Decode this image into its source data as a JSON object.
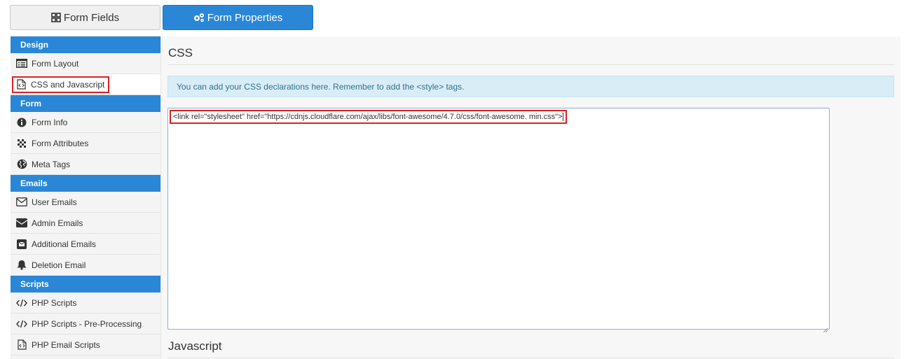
{
  "tabs": {
    "form_fields": "Form Fields",
    "form_properties": "Form Properties"
  },
  "sidebar": {
    "sections": [
      {
        "title": "Design",
        "items": [
          {
            "label": "Form Layout",
            "icon": "layout-list-icon"
          },
          {
            "label": "CSS and Javascript",
            "icon": "code-file-icon",
            "active": true
          }
        ]
      },
      {
        "title": "Form",
        "items": [
          {
            "label": "Form Info",
            "icon": "info-circle-icon"
          },
          {
            "label": "Form Attributes",
            "icon": "checkered-icon"
          },
          {
            "label": "Meta Tags",
            "icon": "globe-icon"
          }
        ]
      },
      {
        "title": "Emails",
        "items": [
          {
            "label": "User Emails",
            "icon": "envelope-outline-icon"
          },
          {
            "label": "Admin Emails",
            "icon": "envelope-solid-icon"
          },
          {
            "label": "Additional Emails",
            "icon": "envelope-square-icon"
          },
          {
            "label": "Deletion Email",
            "icon": "bell-icon"
          }
        ]
      },
      {
        "title": "Scripts",
        "items": [
          {
            "label": "PHP Scripts",
            "icon": "code-icon"
          },
          {
            "label": "PHP Scripts - Pre-Processing",
            "icon": "code-icon"
          },
          {
            "label": "PHP Email Scripts",
            "icon": "code-file-icon"
          }
        ]
      }
    ]
  },
  "main": {
    "css_heading": "CSS",
    "info_text": "You can add your CSS declarations here. Remember to add the <style> tags.",
    "css_editor_value": "<link rel=\"stylesheet\" href=\"https://cdnjs.cloudflare.com/ajax/libs/font-awesome/4.7.0/css/font-awesome. min.css\">",
    "js_heading": "Javascript"
  },
  "colors": {
    "accent": "#2a87d7",
    "highlight": "#e01f1f",
    "info_bg": "#d9edf7",
    "info_text": "#31708f"
  }
}
